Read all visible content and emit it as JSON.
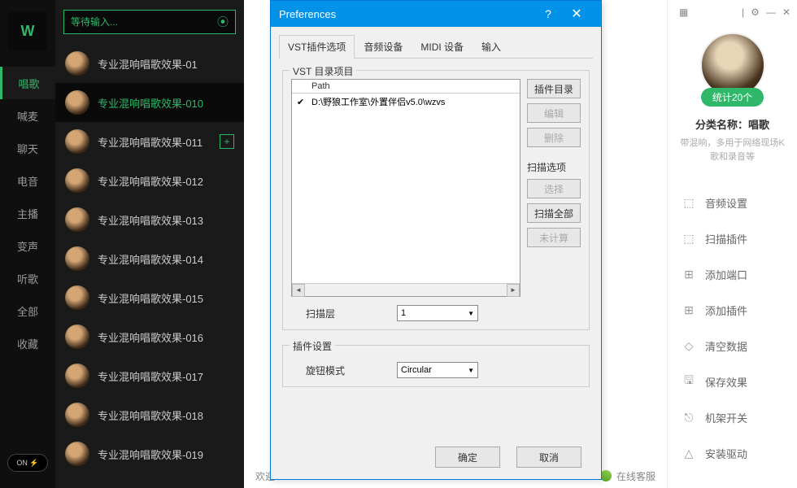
{
  "search": {
    "placeholder": "等待输入..."
  },
  "nav": {
    "items": [
      "唱歌",
      "喊麦",
      "聊天",
      "电音",
      "主播",
      "变声",
      "听歌",
      "全部",
      "收藏"
    ],
    "active_index": 0,
    "toggle": "ON ⚡"
  },
  "effects": {
    "items": [
      "专业混响唱歌效果-01",
      "专业混响唱歌效果-010",
      "专业混响唱歌效果-011",
      "专业混响唱歌效果-012",
      "专业混响唱歌效果-013",
      "专业混响唱歌效果-014",
      "专业混响唱歌效果-015",
      "专业混响唱歌效果-016",
      "专业混响唱歌效果-017",
      "专业混响唱歌效果-018",
      "专业混响唱歌效果-019"
    ],
    "selected_index": 1,
    "hover_index": 2
  },
  "status": {
    "welcome": "欢迎",
    "support": "在线客服"
  },
  "right": {
    "badge": "统计20个",
    "title": "分类名称：唱歌",
    "desc": "带混响，多用于网络现场K歌和录音等",
    "menu": [
      "音频设置",
      "扫描插件",
      "添加端口",
      "添加插件",
      "清空数据",
      "保存效果",
      "机架开关",
      "安装驱动"
    ]
  },
  "dialog": {
    "title": "Preferences",
    "tabs": [
      "VST插件选项",
      "音频设备",
      "MIDI 设备",
      "输入"
    ],
    "active_tab": 0,
    "group1": "VST 目录项目",
    "path_header": "Path",
    "path_value": "D:\\野狼工作室\\外置伴侣v5.0\\wzvs",
    "buttons": {
      "dir": "插件目录",
      "edit": "编辑",
      "delete": "删除",
      "scan_opts": "扫描选项",
      "choose": "选择",
      "scan_all": "扫描全部",
      "uncalc": "未计算"
    },
    "scan_layer_label": "扫描层",
    "scan_layer_value": "1",
    "group2": "插件设置",
    "knob_label": "旋钮模式",
    "knob_value": "Circular",
    "ok": "确定",
    "cancel": "取消"
  }
}
